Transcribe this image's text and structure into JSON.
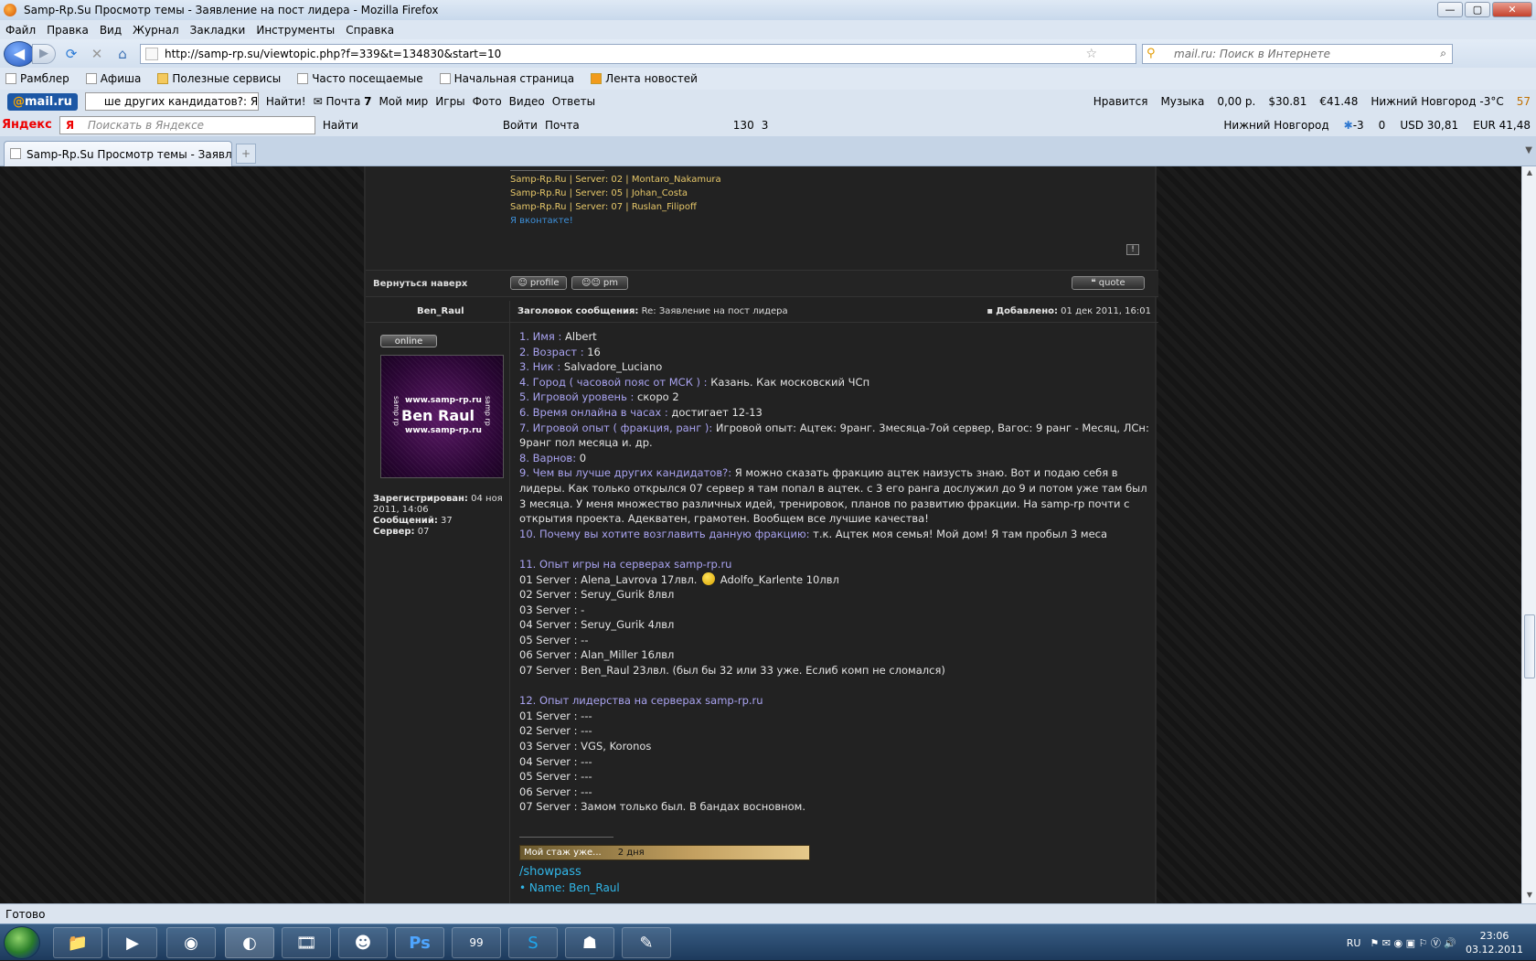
{
  "window": {
    "title": "Samp-Rp.Su Просмотр темы - Заявление на пост лидера - Mozilla Firefox",
    "min_glyph": "—",
    "max_glyph": "▢",
    "close_glyph": "✕"
  },
  "menu": [
    "Файл",
    "Правка",
    "Вид",
    "Журнал",
    "Закладки",
    "Инструменты",
    "Справка"
  ],
  "nav": {
    "url": "http://samp-rp.su/viewtopic.php?f=339&t=134830&start=10",
    "search_placeholder": "mail.ru: Поиск в Интернете",
    "back_icon": "back-arrow-icon",
    "reload_icon": "reload-icon",
    "home_icon": "home-icon"
  },
  "bookmarks": [
    "Рамблер",
    "Афиша",
    "Полезные сервисы",
    "Часто посещаемые",
    "Начальная страница",
    "Лента новостей"
  ],
  "mailbar": {
    "logo": "mail.ru",
    "logo_prefix": "@",
    "query": "ше других кандидатов?: Я м",
    "find": "Найти!",
    "pochta": "Почта",
    "pochta_count": "7",
    "moy_mir": "Мой мир",
    "igry": "Игры",
    "foto": "Фото",
    "video": "Видео",
    "otvety": "Ответы",
    "nravitsya": "Нравится",
    "muzyka": "Музыка",
    "balance": "0,00 р.",
    "usd": "30.81",
    "eur": "41.48",
    "weather": "Нижний Новгород -3°C",
    "notif": "57"
  },
  "yandexbar": {
    "logo": "Яндекс",
    "logo_char": "Я",
    "placeholder": "Поискать в Яндексе",
    "find": "Найти",
    "voiti": "Войти",
    "pochta": "Почта",
    "count_130": "130",
    "count_3": "3",
    "city": "Нижний Новгород",
    "temp": "-3",
    "zero": "0",
    "usd": "USD 30,81",
    "eur": "EUR 41,48"
  },
  "tab": {
    "title": "Samp-Rp.Su Просмотр темы - Заявл...",
    "new_tab": "+",
    "list_glyph": "▼"
  },
  "prev_post": {
    "sig_lines": [
      "Samp-Rp.Ru | Server: 02 | Montaro_Nakamura",
      "Samp-Rp.Ru | Server: 05 | Johan_Costa",
      "Samp-Rp.Ru | Server: 07 | Ruslan_Filipoff"
    ],
    "vk": "Я вконтакте!",
    "warn": "!",
    "back_to_top": "Вернуться наверх",
    "profile": "profile",
    "pm": "pm",
    "quote": "quote"
  },
  "post": {
    "author": "Ben_Raul",
    "subject_label": "Заголовок сообщения:",
    "subject": "Re: Заявление на пост лидера",
    "added_label": "Добавлено:",
    "added": "01 дек 2011, 16:01",
    "online": "online",
    "avatar": {
      "url1": "www.samp-rp.ru",
      "name": "Ben Raul",
      "url2": "www.samp-rp.ru",
      "side": "samp rp"
    },
    "registered_label": "Зарегистрирован:",
    "registered": "04 ноя 2011, 14:06",
    "messages_label": "Сообщений:",
    "messages": "37",
    "server_label": "Сервер:",
    "server": "07",
    "qa": [
      {
        "q": "1. Имя :",
        "a": " Albert"
      },
      {
        "q": "2. Возраст :",
        "a": " 16"
      },
      {
        "q": "3. Ник :",
        "a": " Salvadore_Luciano"
      },
      {
        "q": "4. Город ( часовой пояс от МСК ) :",
        "a": " Казань. Как московский ЧСп"
      },
      {
        "q": "5. Игровой уровень :",
        "a": " скоро 2"
      },
      {
        "q": "6. Время онлайна в часах :",
        "a": " достигает 12-13"
      },
      {
        "q": "7. Игровой опыт ( фракция, ранг ):",
        "a": " Игровой опыт: Ацтек: 9ранг. 3месяца-7ой сервер, Вагос: 9 ранг - Месяц, ЛСн: 9ранг пол месяца и. др."
      },
      {
        "q": "8. Варнов:",
        "a": " 0"
      },
      {
        "q": "9. Чем вы лучше других кандидатов?:",
        "a": " Я можно сказать фракцию ацтек наизусть знаю. Вот и подаю себя в лидеры. Как только открылся 07 сервер я там попал в ацтек. с 3 его ранга дослужил до 9 и потом уже там был 3 месяца. У меня множество различных идей, тренировок, планов по развитию фракции. На samp-rp почти с открытия проекта. Адекватен, грамотен. Вообщем все лучшие качества!"
      },
      {
        "q": "10. Почему вы хотите возглавить данную фракцию:",
        "a": " т.к. Ацтек моя семья! Мой дом! Я там пробыл 3 меса"
      }
    ],
    "exp_title": "11. Опыт игры на серверах samp-rp.ru",
    "exp": [
      "01 Server : Alena_Lavrova 17лвл.",
      "02 Server : Seruy_Gurik 8лвл",
      "03 Server : -",
      "04 Server : Seruy_Gurik 4лвл",
      "05 Server : --",
      "06 Server : Alan_Miller 16лвл",
      "07 Server : Ben_Raul 23лвл. (был бы 32 или 33 уже. Еслиб комп не сломался)"
    ],
    "exp_tail": "Adolfo_Karlente 10лвл",
    "lead_title": "12. Опыт лидерства на серверах samp-rp.ru",
    "lead": [
      "01 Server : ---",
      "02 Server : ---",
      "03 Server : VGS, Koronos",
      "04 Server : ---",
      "05 Server : ---",
      "06 Server : ---",
      "07 Server : Замом только был. В бандах восновном."
    ],
    "sig": {
      "userbar": "Мой стаж уже...",
      "userbar_days": "2 дня",
      "showpass": "/showpass",
      "name_line": "• Name: Ben_Raul"
    }
  },
  "status": "Готово",
  "taskbar": {
    "lang": "RU",
    "time": "23:06",
    "date": "03.12.2011",
    "ps": "Ps",
    "badge": "99"
  }
}
